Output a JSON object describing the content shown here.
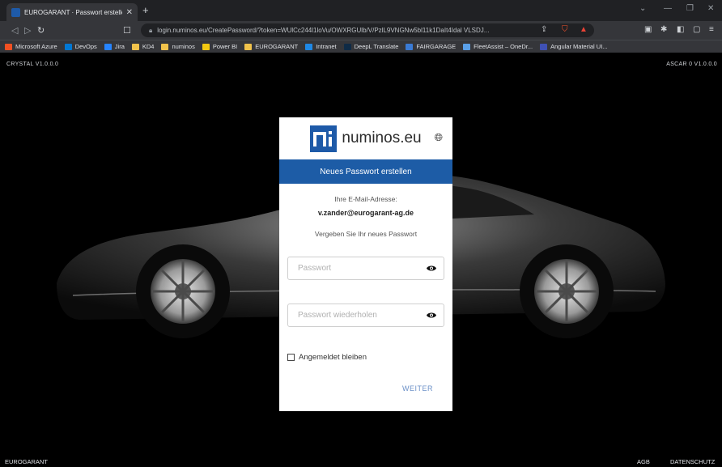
{
  "browser": {
    "tab_title": "EUROGARANT · Passwort erstellen",
    "url": "login.numinos.eu/CreatePassword/?token=WUlCc244l1loVu/OWXRGUlb/V/PzlL9VNGNw5bl11k1DaIt4Idal VLSDJ...",
    "bookmarks": [
      "Microsoft Azure",
      "DevOps",
      "Jira",
      "KD4",
      "numinos",
      "Power BI",
      "EUROGARANT",
      "Intranet",
      "DeepL Translate",
      "FAIRGARAGE",
      "FleetAssist – OneDr...",
      "Angular Material UI..."
    ],
    "bookmark_colors": [
      "#f25022",
      "#0078d4",
      "#2684ff",
      "#f0c24b",
      "#f0c24b",
      "#f2c811",
      "#f0c24b",
      "#1e88e5",
      "#0f2b46",
      "#3a7bd5",
      "#5aa0e8",
      "#3f51b5"
    ]
  },
  "page": {
    "top_left": "CRYSTAL V1.0.0.0",
    "top_right": "ASCAR 0 V1.0.0.0",
    "footer_left": "EUROGARANT",
    "footer_agb": "AGB",
    "footer_datenschutz": "DATENSCHUTZ"
  },
  "card": {
    "logo_text": "numinos.eu",
    "banner": "Neues Passwort erstellen",
    "email_label": "Ihre E-Mail-Adresse:",
    "email": "v.zander@eurogarant-ag.de",
    "instruction": "Vergeben Sie Ihr neues Passwort",
    "password_placeholder": "Passwort",
    "password_repeat_placeholder": "Passwort wiederholen",
    "remember_label": "Angemeldet bleiben",
    "submit": "WEITER"
  }
}
